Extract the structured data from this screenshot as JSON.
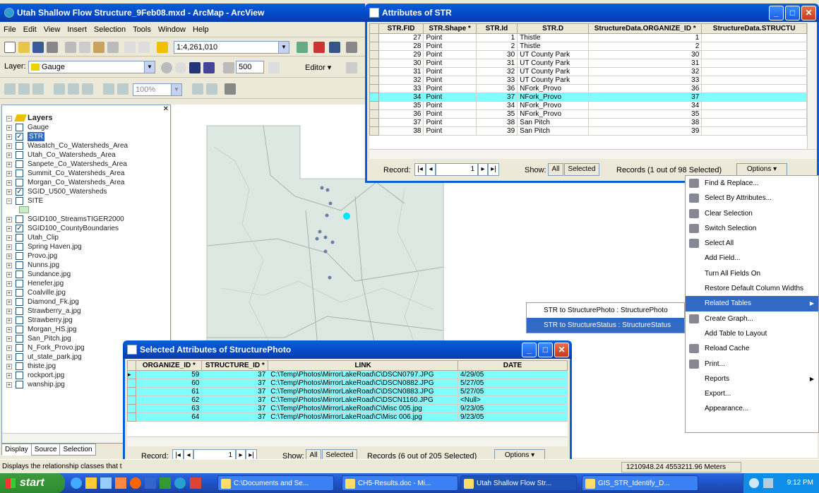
{
  "arcmap": {
    "title": "Utah Shallow Flow Structure_9Feb08.mxd - ArcMap - ArcView",
    "menu": [
      "File",
      "Edit",
      "View",
      "Insert",
      "Selection",
      "Tools",
      "Window",
      "Help"
    ],
    "scale": "1:4,261,010",
    "layer_label": "Layer:",
    "layer_value": "Gauge",
    "snap_value": "500",
    "editor_label": "Editor ▾",
    "zoom_pct": "100%",
    "toc": [
      {
        "label": "Layers",
        "pm": "−",
        "check": "",
        "bold": true
      },
      {
        "label": "Gauge",
        "pm": "+",
        "check": ""
      },
      {
        "label": "STR",
        "pm": "+",
        "check": "✓",
        "selected": true
      },
      {
        "label": "Wasatch_Co_Watersheds_Area",
        "pm": "+",
        "check": ""
      },
      {
        "label": "Utah_Co_Watersheds_Area",
        "pm": "+",
        "check": ""
      },
      {
        "label": "Sanpete_Co_Watersheds_Area",
        "pm": "+",
        "check": ""
      },
      {
        "label": "Summit_Co_Watersheds_Area",
        "pm": "+",
        "check": ""
      },
      {
        "label": "Morgan_Co_Watersheds_Area",
        "pm": "+",
        "check": ""
      },
      {
        "label": "SGID_U500_Watersheds",
        "pm": "+",
        "check": "✓"
      },
      {
        "label": "SITE",
        "pm": "−",
        "check": ""
      },
      {
        "label": "",
        "pm": "",
        "check": "",
        "swatch": true
      },
      {
        "label": "SGID100_StreamsTIGER2000",
        "pm": "+",
        "check": ""
      },
      {
        "label": "SGID100_CountyBoundaries",
        "pm": "+",
        "check": "✓"
      },
      {
        "label": "Utah_Clip",
        "pm": "+",
        "check": ""
      },
      {
        "label": "Spring Haven.jpg",
        "pm": "+",
        "check": ""
      },
      {
        "label": "Provo.jpg",
        "pm": "+",
        "check": ""
      },
      {
        "label": "Nunns.jpg",
        "pm": "+",
        "check": ""
      },
      {
        "label": "Sundance.jpg",
        "pm": "+",
        "check": ""
      },
      {
        "label": "Henefer.jpg",
        "pm": "+",
        "check": ""
      },
      {
        "label": "Coalville.jpg",
        "pm": "+",
        "check": ""
      },
      {
        "label": "Diamond_Fk.jpg",
        "pm": "+",
        "check": ""
      },
      {
        "label": "Strawberry_a.jpg",
        "pm": "+",
        "check": ""
      },
      {
        "label": "Strawberry.jpg",
        "pm": "+",
        "check": ""
      },
      {
        "label": "Morgan_HS.jpg",
        "pm": "+",
        "check": ""
      },
      {
        "label": "San_Pitch.jpg",
        "pm": "+",
        "check": ""
      },
      {
        "label": "N_Fork_Provo.jpg",
        "pm": "+",
        "check": ""
      },
      {
        "label": "ut_state_park.jpg",
        "pm": "+",
        "check": ""
      },
      {
        "label": "thiste.jpg",
        "pm": "+",
        "check": ""
      },
      {
        "label": "rockport.jpg",
        "pm": "+",
        "check": ""
      },
      {
        "label": "wanship.jpg",
        "pm": "+",
        "check": ""
      }
    ],
    "tabs": [
      "Display",
      "Source",
      "Selection"
    ],
    "status_left": "Displays the relationship classes that t",
    "status_coords": "1210948.24  4553211.96 Meters"
  },
  "str_window": {
    "title": "Attributes of STR",
    "columns": [
      "STR.FID",
      "STR.Shape *",
      "STR.Id",
      "STR.D",
      "StructureData.ORGANIZE_ID *",
      "StructureData.STRUCTU"
    ],
    "rows": [
      [
        "27",
        "Point",
        "1",
        "Thistle",
        "1",
        ""
      ],
      [
        "28",
        "Point",
        "2",
        "Thistle",
        "2",
        ""
      ],
      [
        "29",
        "Point",
        "30",
        "UT County Park",
        "30",
        ""
      ],
      [
        "30",
        "Point",
        "31",
        "UT County Park",
        "31",
        ""
      ],
      [
        "31",
        "Point",
        "32",
        "UT County Park",
        "32",
        ""
      ],
      [
        "32",
        "Point",
        "33",
        "UT County Park",
        "33",
        ""
      ],
      [
        "33",
        "Point",
        "36",
        "NFork_Provo",
        "36",
        ""
      ],
      [
        "34",
        "Point",
        "37",
        "NFork_Provo",
        "37",
        ""
      ],
      [
        "35",
        "Point",
        "34",
        "NFork_Provo",
        "34",
        ""
      ],
      [
        "36",
        "Point",
        "35",
        "NFork_Provo",
        "35",
        ""
      ],
      [
        "37",
        "Point",
        "38",
        "San Pitch",
        "38",
        ""
      ],
      [
        "38",
        "Point",
        "39",
        "San Pitch",
        "39",
        ""
      ]
    ],
    "selected_row": 7,
    "record_label": "Record:",
    "record_value": "1",
    "show_label": "Show:",
    "show_all": "All",
    "show_selected": "Selected",
    "records_text": "Records (1 out of 98 Selected)",
    "options": "Options ▾"
  },
  "photo_window": {
    "title": "Selected Attributes of StructurePhoto",
    "columns": [
      "ORGANIZE_ID *",
      "STRUCTURE_ID *",
      "LINK",
      "DATE"
    ],
    "rows": [
      [
        "59",
        "37",
        "C:\\Temp\\Photos\\MirrorLakeRoad\\C\\DSCN0797.JPG",
        "4/29/05"
      ],
      [
        "60",
        "37",
        "C:\\Temp\\Photos\\MirrorLakeRoad\\C\\DSCN0882.JPG",
        "5/27/05"
      ],
      [
        "61",
        "37",
        "C:\\Temp\\Photos\\MirrorLakeRoad\\C\\DSCN0883.JPG",
        "5/27/05"
      ],
      [
        "62",
        "37",
        "C:\\Temp\\Photos\\MirrorLakeRoad\\C\\DSCN1160.JPG",
        "<Null>"
      ],
      [
        "63",
        "37",
        "C:\\Temp\\Photos\\MirrorLakeRoad\\C\\Misc 005.jpg",
        "9/23/05"
      ],
      [
        "64",
        "37",
        "C:\\Temp\\Photos\\MirrorLakeRoad\\C\\Misc 006.jpg",
        "9/23/05"
      ]
    ],
    "record_label": "Record:",
    "record_value": "1",
    "show_label": "Show:",
    "show_all": "All",
    "show_selected": "Selected",
    "records_text": "Records (6 out of 205 Selected)",
    "options": "Options ▾"
  },
  "context_menu": {
    "items": [
      {
        "label": "Find & Replace...",
        "icon": "binoculars-icon"
      },
      {
        "label": "Select By Attributes...",
        "icon": "sql-icon"
      },
      {
        "label": "Clear Selection",
        "icon": "clear-selection-icon"
      },
      {
        "label": "Switch Selection",
        "icon": "switch-selection-icon"
      },
      {
        "label": "Select All",
        "icon": "select-all-icon"
      },
      {
        "label": "Add Field...",
        "icon": ""
      },
      {
        "label": "Turn All Fields On",
        "icon": ""
      },
      {
        "label": "Restore Default Column Widths",
        "icon": ""
      },
      {
        "label": "Related Tables",
        "icon": "",
        "submenu": true,
        "highlighted": true
      },
      {
        "label": "Create Graph...",
        "icon": "graph-icon"
      },
      {
        "label": "Add Table to Layout",
        "icon": ""
      },
      {
        "label": "Reload Cache",
        "icon": "reload-icon"
      },
      {
        "label": "Print...",
        "icon": "printer-icon"
      },
      {
        "label": "Reports",
        "icon": "",
        "submenu": true
      },
      {
        "label": "Export...",
        "icon": ""
      },
      {
        "label": "Appearance...",
        "icon": ""
      }
    ],
    "submenu": [
      {
        "label": "STR to StructurePhoto : StructurePhoto",
        "highlighted": false
      },
      {
        "label": "STR to StructureStatus : StructureStatus",
        "highlighted": true
      }
    ]
  },
  "taskbar": {
    "start": "start",
    "tasks": [
      {
        "label": "C:\\Documents and Se..."
      },
      {
        "label": "CH5-Results.doc - Mi..."
      },
      {
        "label": "Utah Shallow Flow Str...",
        "active": true
      },
      {
        "label": "GIS_STR_Identify_D..."
      }
    ],
    "clock": "9:12 PM"
  },
  "colors": {
    "selection": "#7fffff",
    "xp_blue": "#0a5fd8",
    "menu_highlight": "#316ac5",
    "map_fill": "#dde8e2"
  }
}
